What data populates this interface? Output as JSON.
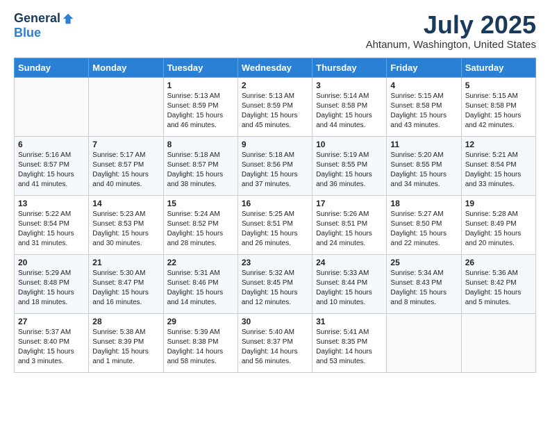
{
  "header": {
    "logo_general": "General",
    "logo_blue": "Blue",
    "title": "July 2025",
    "subtitle": "Ahtanum, Washington, United States"
  },
  "weekdays": [
    "Sunday",
    "Monday",
    "Tuesday",
    "Wednesday",
    "Thursday",
    "Friday",
    "Saturday"
  ],
  "weeks": [
    [
      {
        "day": "",
        "sunrise": "",
        "sunset": "",
        "daylight": ""
      },
      {
        "day": "",
        "sunrise": "",
        "sunset": "",
        "daylight": ""
      },
      {
        "day": "1",
        "sunrise": "Sunrise: 5:13 AM",
        "sunset": "Sunset: 8:59 PM",
        "daylight": "Daylight: 15 hours and 46 minutes."
      },
      {
        "day": "2",
        "sunrise": "Sunrise: 5:13 AM",
        "sunset": "Sunset: 8:59 PM",
        "daylight": "Daylight: 15 hours and 45 minutes."
      },
      {
        "day": "3",
        "sunrise": "Sunrise: 5:14 AM",
        "sunset": "Sunset: 8:58 PM",
        "daylight": "Daylight: 15 hours and 44 minutes."
      },
      {
        "day": "4",
        "sunrise": "Sunrise: 5:15 AM",
        "sunset": "Sunset: 8:58 PM",
        "daylight": "Daylight: 15 hours and 43 minutes."
      },
      {
        "day": "5",
        "sunrise": "Sunrise: 5:15 AM",
        "sunset": "Sunset: 8:58 PM",
        "daylight": "Daylight: 15 hours and 42 minutes."
      }
    ],
    [
      {
        "day": "6",
        "sunrise": "Sunrise: 5:16 AM",
        "sunset": "Sunset: 8:57 PM",
        "daylight": "Daylight: 15 hours and 41 minutes."
      },
      {
        "day": "7",
        "sunrise": "Sunrise: 5:17 AM",
        "sunset": "Sunset: 8:57 PM",
        "daylight": "Daylight: 15 hours and 40 minutes."
      },
      {
        "day": "8",
        "sunrise": "Sunrise: 5:18 AM",
        "sunset": "Sunset: 8:57 PM",
        "daylight": "Daylight: 15 hours and 38 minutes."
      },
      {
        "day": "9",
        "sunrise": "Sunrise: 5:18 AM",
        "sunset": "Sunset: 8:56 PM",
        "daylight": "Daylight: 15 hours and 37 minutes."
      },
      {
        "day": "10",
        "sunrise": "Sunrise: 5:19 AM",
        "sunset": "Sunset: 8:55 PM",
        "daylight": "Daylight: 15 hours and 36 minutes."
      },
      {
        "day": "11",
        "sunrise": "Sunrise: 5:20 AM",
        "sunset": "Sunset: 8:55 PM",
        "daylight": "Daylight: 15 hours and 34 minutes."
      },
      {
        "day": "12",
        "sunrise": "Sunrise: 5:21 AM",
        "sunset": "Sunset: 8:54 PM",
        "daylight": "Daylight: 15 hours and 33 minutes."
      }
    ],
    [
      {
        "day": "13",
        "sunrise": "Sunrise: 5:22 AM",
        "sunset": "Sunset: 8:54 PM",
        "daylight": "Daylight: 15 hours and 31 minutes."
      },
      {
        "day": "14",
        "sunrise": "Sunrise: 5:23 AM",
        "sunset": "Sunset: 8:53 PM",
        "daylight": "Daylight: 15 hours and 30 minutes."
      },
      {
        "day": "15",
        "sunrise": "Sunrise: 5:24 AM",
        "sunset": "Sunset: 8:52 PM",
        "daylight": "Daylight: 15 hours and 28 minutes."
      },
      {
        "day": "16",
        "sunrise": "Sunrise: 5:25 AM",
        "sunset": "Sunset: 8:51 PM",
        "daylight": "Daylight: 15 hours and 26 minutes."
      },
      {
        "day": "17",
        "sunrise": "Sunrise: 5:26 AM",
        "sunset": "Sunset: 8:51 PM",
        "daylight": "Daylight: 15 hours and 24 minutes."
      },
      {
        "day": "18",
        "sunrise": "Sunrise: 5:27 AM",
        "sunset": "Sunset: 8:50 PM",
        "daylight": "Daylight: 15 hours and 22 minutes."
      },
      {
        "day": "19",
        "sunrise": "Sunrise: 5:28 AM",
        "sunset": "Sunset: 8:49 PM",
        "daylight": "Daylight: 15 hours and 20 minutes."
      }
    ],
    [
      {
        "day": "20",
        "sunrise": "Sunrise: 5:29 AM",
        "sunset": "Sunset: 8:48 PM",
        "daylight": "Daylight: 15 hours and 18 minutes."
      },
      {
        "day": "21",
        "sunrise": "Sunrise: 5:30 AM",
        "sunset": "Sunset: 8:47 PM",
        "daylight": "Daylight: 15 hours and 16 minutes."
      },
      {
        "day": "22",
        "sunrise": "Sunrise: 5:31 AM",
        "sunset": "Sunset: 8:46 PM",
        "daylight": "Daylight: 15 hours and 14 minutes."
      },
      {
        "day": "23",
        "sunrise": "Sunrise: 5:32 AM",
        "sunset": "Sunset: 8:45 PM",
        "daylight": "Daylight: 15 hours and 12 minutes."
      },
      {
        "day": "24",
        "sunrise": "Sunrise: 5:33 AM",
        "sunset": "Sunset: 8:44 PM",
        "daylight": "Daylight: 15 hours and 10 minutes."
      },
      {
        "day": "25",
        "sunrise": "Sunrise: 5:34 AM",
        "sunset": "Sunset: 8:43 PM",
        "daylight": "Daylight: 15 hours and 8 minutes."
      },
      {
        "day": "26",
        "sunrise": "Sunrise: 5:36 AM",
        "sunset": "Sunset: 8:42 PM",
        "daylight": "Daylight: 15 hours and 5 minutes."
      }
    ],
    [
      {
        "day": "27",
        "sunrise": "Sunrise: 5:37 AM",
        "sunset": "Sunset: 8:40 PM",
        "daylight": "Daylight: 15 hours and 3 minutes."
      },
      {
        "day": "28",
        "sunrise": "Sunrise: 5:38 AM",
        "sunset": "Sunset: 8:39 PM",
        "daylight": "Daylight: 15 hours and 1 minute."
      },
      {
        "day": "29",
        "sunrise": "Sunrise: 5:39 AM",
        "sunset": "Sunset: 8:38 PM",
        "daylight": "Daylight: 14 hours and 58 minutes."
      },
      {
        "day": "30",
        "sunrise": "Sunrise: 5:40 AM",
        "sunset": "Sunset: 8:37 PM",
        "daylight": "Daylight: 14 hours and 56 minutes."
      },
      {
        "day": "31",
        "sunrise": "Sunrise: 5:41 AM",
        "sunset": "Sunset: 8:35 PM",
        "daylight": "Daylight: 14 hours and 53 minutes."
      },
      {
        "day": "",
        "sunrise": "",
        "sunset": "",
        "daylight": ""
      },
      {
        "day": "",
        "sunrise": "",
        "sunset": "",
        "daylight": ""
      }
    ]
  ]
}
